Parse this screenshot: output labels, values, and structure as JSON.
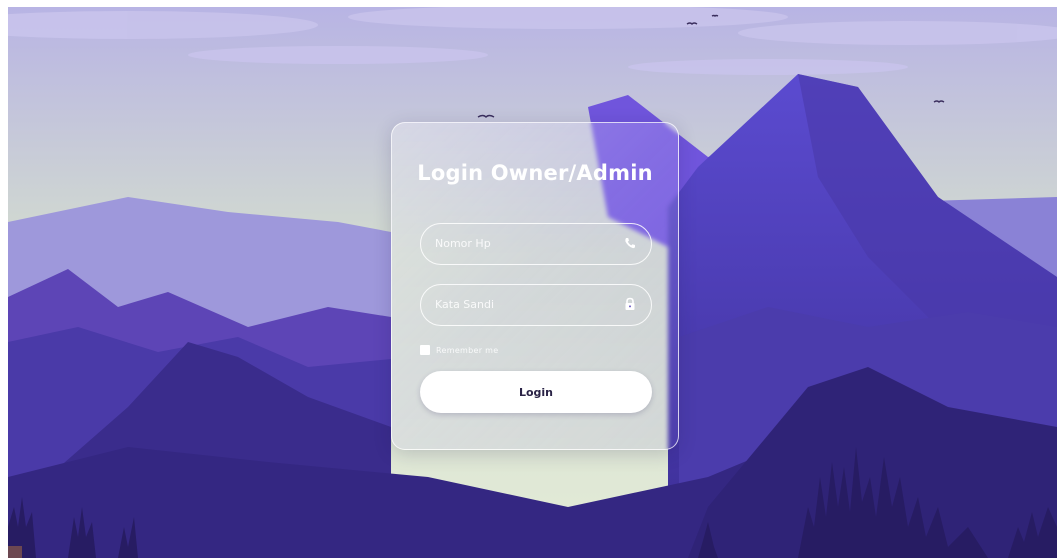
{
  "login": {
    "title": "Login Owner/Admin",
    "username_placeholder": "Nomor Hp",
    "username_value": "",
    "password_placeholder": "Kata Sandi",
    "password_value": "",
    "remember_label": "Remember me",
    "submit_label": "Login"
  },
  "icons": {
    "username": "phone-icon",
    "password": "lock-icon"
  },
  "colors": {
    "sky_top": "#b9b6e6",
    "sky_bottom": "#dfe9d6",
    "mountain_far": "#8b84d8",
    "mountain_mid": "#5a44b8",
    "mountain_near": "#3b2a86",
    "accent": "#6f4fe0"
  }
}
